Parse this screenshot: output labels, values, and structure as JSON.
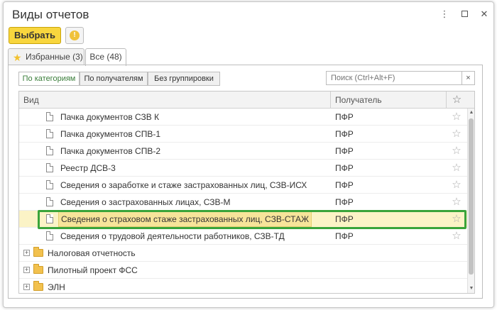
{
  "window": {
    "title": "Виды отчетов",
    "more_icon": "vertical-ellipsis-icon",
    "maximize_icon": "maximize-icon",
    "close_icon": "close-icon"
  },
  "toolbar": {
    "select_label": "Выбрать",
    "info_icon": "info-icon",
    "info_glyph": "!"
  },
  "tabs": [
    {
      "label": "Избранные (3)",
      "icon": "star-icon",
      "active": false
    },
    {
      "label": "Все (48)",
      "active": true
    }
  ],
  "grouping": [
    {
      "label": "По категориям",
      "active": true
    },
    {
      "label": "По получателям",
      "active": false
    },
    {
      "label": "Без группировки",
      "active": false
    }
  ],
  "search": {
    "placeholder": "Поиск (Ctrl+Alt+F)",
    "value": "",
    "clear_glyph": "×"
  },
  "table": {
    "columns": [
      "Вид",
      "Получатель",
      "☆"
    ],
    "rows": [
      {
        "name": "Пачка документов СЗВ К",
        "recipient": "ПФР",
        "fav": "☆"
      },
      {
        "name": "Пачка документов СПВ-1",
        "recipient": "ПФР",
        "fav": "☆"
      },
      {
        "name": "Пачка документов СПВ-2",
        "recipient": "ПФР",
        "fav": "☆"
      },
      {
        "name": "Реестр ДСВ-3",
        "recipient": "ПФР",
        "fav": "☆"
      },
      {
        "name": "Сведения о заработке и стаже застрахованных лиц, СЗВ-ИСХ",
        "recipient": "ПФР",
        "fav": "☆"
      },
      {
        "name": "Сведения о застрахованных лицах, СЗВ-М",
        "recipient": "ПФР",
        "fav": "☆"
      },
      {
        "name": "Сведения о страховом стаже застрахованных лиц, СЗВ-СТАЖ",
        "recipient": "ПФР",
        "fav": "☆",
        "selected": true
      },
      {
        "name": "Сведения о трудовой деятельности работников, СЗВ-ТД",
        "recipient": "ПФР",
        "fav": "☆"
      }
    ],
    "folders": [
      {
        "name": "Налоговая отчетность",
        "expander": "+"
      },
      {
        "name": "Пилотный проект ФСС",
        "expander": "+"
      },
      {
        "name": "ЭЛН",
        "expander": "+"
      }
    ]
  },
  "colors": {
    "accent_button": "#f8d63e",
    "selected_row": "#fbf3c6",
    "highlight_frame": "#3aa43a",
    "active_group": "#3a7d3a"
  }
}
